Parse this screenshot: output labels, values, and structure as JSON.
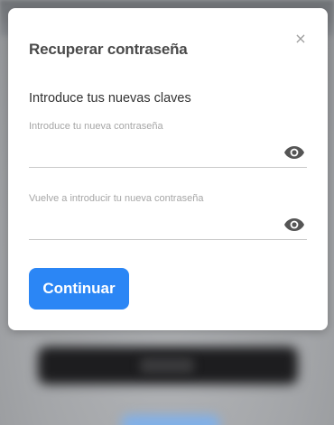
{
  "modal": {
    "title": "Recuperar contraseña",
    "close_symbol": "×",
    "heading": "Introduce tus nuevas claves",
    "fields": [
      {
        "label": "Introduce tu nueva contraseña",
        "value": "",
        "toggle_icon": "eye-icon"
      },
      {
        "label": "Vuelve a introducir tu nueva contraseña",
        "value": "",
        "toggle_icon": "eye-icon"
      }
    ],
    "submit_label": "Continuar"
  },
  "colors": {
    "primary": "#2b86f5",
    "title_text": "#4a4a4a",
    "label_text": "#a6a6a6",
    "icon": "#555555",
    "overlay": "#9a9c9f"
  }
}
